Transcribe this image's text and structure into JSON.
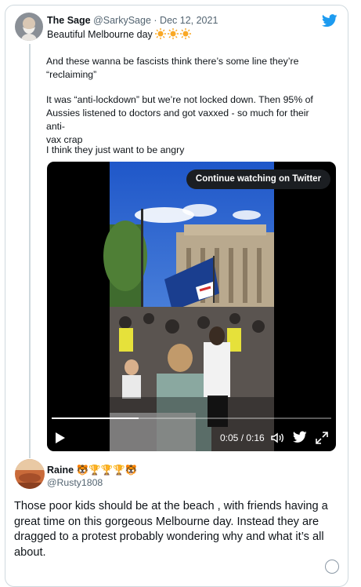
{
  "tweet": {
    "author_name": "The Sage",
    "handle": "@SarkySage",
    "separator": "·",
    "date": "Dec 12, 2021",
    "first_line": "Beautiful Melbourne day",
    "suns": "☀️☀️☀️",
    "paragraphs": [
      "And these wanna be fascists think there’s some line they’re\n“reclaiming”",
      "It was “anti-lockdown” but we’re not locked down. Then 95% of\nAussies listened to doctors and got vaxxed - so much for their anti-\nvax crap",
      "I think they just want to be angry"
    ],
    "video": {
      "continue_label": "Continue watching on Twitter",
      "time": "0:05 / 0:16",
      "progress_fraction": 0.31
    }
  },
  "reply": {
    "author_name": "Raine",
    "emojis": "🐯🏆🏆🏆🐯",
    "handle": "@Rusty1808",
    "text": "Those poor kids should be at the beach , with friends having a great time on this gorgeous Melbourne day. Instead they are dragged to a protest probably wondering why and what it’s all about."
  },
  "icons": [
    "twitter-bird-icon",
    "play-icon",
    "volume-icon",
    "twitter-icon",
    "fullscreen-icon",
    "more-icon"
  ],
  "colors": {
    "twitter_blue": "#1d9bf0",
    "secondary_text": "#536471",
    "border": "#cfd9de"
  }
}
